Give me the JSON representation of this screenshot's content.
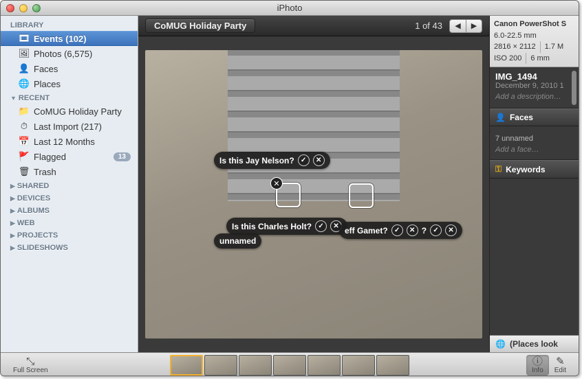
{
  "window": {
    "title": "iPhoto"
  },
  "sidebar": {
    "sections": [
      {
        "header": "LIBRARY",
        "disclosure": false,
        "items": [
          {
            "icon": "🎞",
            "label": "Events (102)",
            "selected": true
          },
          {
            "icon": "🖼",
            "label": "Photos (6,575)"
          },
          {
            "icon": "👤",
            "label": "Faces"
          },
          {
            "icon": "🌐",
            "label": "Places"
          }
        ]
      },
      {
        "header": "RECENT",
        "disclosure": true,
        "items": [
          {
            "icon": "📁",
            "label": "CoMUG Holiday Party"
          },
          {
            "icon": "⏱",
            "label": "Last Import (217)"
          },
          {
            "icon": "📅",
            "label": "Last 12 Months"
          },
          {
            "icon": "🚩",
            "label": "Flagged",
            "badge": "13"
          },
          {
            "icon": "🗑",
            "label": "Trash"
          }
        ]
      },
      {
        "header": "SHARED",
        "disclosure": "collapsed"
      },
      {
        "header": "DEVICES",
        "disclosure": "collapsed"
      },
      {
        "header": "ALBUMS",
        "disclosure": "collapsed"
      },
      {
        "header": "WEB",
        "disclosure": "collapsed"
      },
      {
        "header": "PROJECTS",
        "disclosure": "collapsed"
      },
      {
        "header": "SLIDESHOWS",
        "disclosure": "collapsed"
      }
    ]
  },
  "header": {
    "breadcrumb": "CoMUG Holiday Party",
    "counter": "1 of 43"
  },
  "face_tags": {
    "tag1": "Is this Jay Nelson?",
    "tag2": "Is this Charles Holt?",
    "tag3": "eff Gamet?",
    "tag4": "?",
    "unnamed": "unnamed"
  },
  "info": {
    "camera": "Canon PowerShot S",
    "lens": "6.0-22.5 mm",
    "dims": "2816 × 2112",
    "size": "1.7 M",
    "iso": "ISO 200",
    "focal": "6 mm",
    "filename": "IMG_1494",
    "date": "December 9, 2010 1",
    "desc_placeholder": "Add a description…",
    "faces_header": "Faces",
    "faces_count": "7 unnamed",
    "faces_hint": "Add a face…",
    "keywords_header": "Keywords",
    "places_header": "(Places look"
  },
  "bottom": {
    "fullscreen": "Full Screen",
    "info": "Info",
    "edit": "Edit"
  }
}
